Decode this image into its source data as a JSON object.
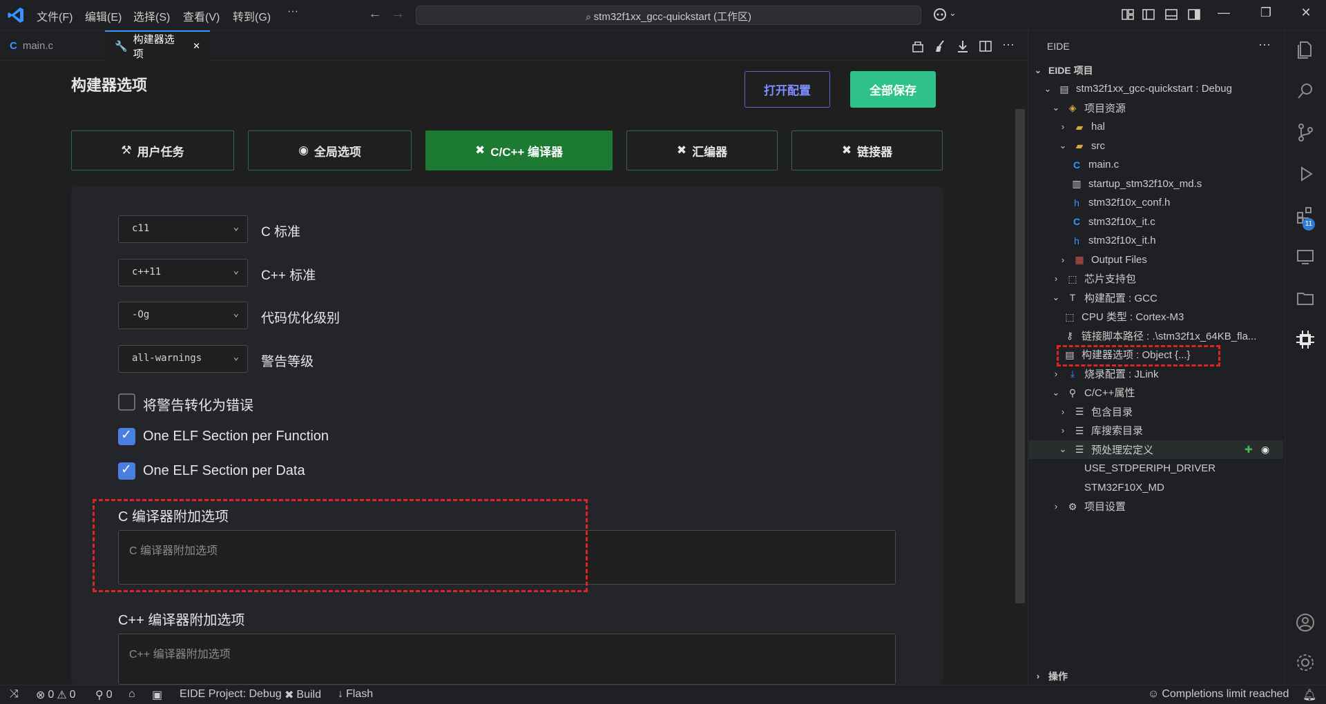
{
  "titlebar": {
    "menus": [
      "文件(F)",
      "编辑(E)",
      "选择(S)",
      "查看(V)",
      "转到(G)",
      "···"
    ],
    "search_text": "stm32f1xx_gcc-quickstart (工作区)"
  },
  "tabs": [
    {
      "label": "main.c",
      "icon": "c-file-icon"
    },
    {
      "label": "构建器选项",
      "icon": "wrench-icon",
      "close": "✕"
    }
  ],
  "editor": {
    "title": "构建器选项",
    "open_config": "打开配置",
    "save_all": "全部保存",
    "section_tabs": [
      "用户任务",
      "全局选项",
      "C/C++ 编译器",
      "汇编器",
      "链接器"
    ],
    "active_tab": "C/C++ 编译器",
    "selects": [
      {
        "value": "c11",
        "label": "C 标准"
      },
      {
        "value": "c++11",
        "label": "C++ 标准"
      },
      {
        "value": "-Og",
        "label": "代码优化级别"
      },
      {
        "value": "all-warnings",
        "label": "警告等级"
      }
    ],
    "checkboxes": [
      {
        "label": "将警告转化为错误",
        "checked": false
      },
      {
        "label": "One ELF Section per Function",
        "checked": true
      },
      {
        "label": "One ELF Section per Data",
        "checked": true
      }
    ],
    "c_extra": {
      "label": "C 编译器附加选项",
      "placeholder": "C 编译器附加选项"
    },
    "cpp_extra": {
      "label": "C++ 编译器附加选项",
      "placeholder": "C++ 编译器附加选项"
    }
  },
  "sidebar": {
    "title": "EIDE",
    "more": "···",
    "section": "EIDE 项目",
    "tree": [
      {
        "label": "stm32f1xx_gcc-quickstart : Debug",
        "chev": "⌄",
        "icon": "project-icon"
      },
      {
        "label": "项目资源",
        "chev": "⌄",
        "icon": "resources-icon"
      },
      {
        "label": "hal",
        "chev": "›",
        "icon": "folder-icon"
      },
      {
        "label": "src",
        "chev": "⌄",
        "icon": "folder-icon"
      },
      {
        "label": "main.c",
        "chev": "",
        "icon": "c-file-icon"
      },
      {
        "label": "startup_stm32f10x_md.s",
        "chev": "",
        "icon": "asm-file-icon"
      },
      {
        "label": "stm32f10x_conf.h",
        "chev": "",
        "icon": "h-file-icon"
      },
      {
        "label": "stm32f10x_it.c",
        "chev": "",
        "icon": "c-file-icon"
      },
      {
        "label": "stm32f10x_it.h",
        "chev": "",
        "icon": "h-file-icon"
      },
      {
        "label": "Output Files",
        "chev": "›",
        "icon": "output-icon"
      },
      {
        "label": "芯片支持包",
        "chev": "›",
        "icon": "chip-icon"
      },
      {
        "label": "构建配置 : GCC",
        "chev": "⌄",
        "icon": "hammer-icon"
      },
      {
        "label": "CPU 类型 : Cortex-M3",
        "chev": "",
        "icon": "cpu-icon"
      },
      {
        "label": "链接脚本路径 : .\\stm32f1x_64KB_fla...",
        "chev": "",
        "icon": "key-icon"
      },
      {
        "label": "构建器选项 : Object {...}",
        "chev": "",
        "icon": "options-icon"
      },
      {
        "label": "烧录配置 : JLink",
        "chev": "›",
        "icon": "download-icon"
      },
      {
        "label": "C/C++属性",
        "chev": "⌄",
        "icon": "wrench-icon"
      },
      {
        "label": "包含目录",
        "chev": "›",
        "icon": "list-icon"
      },
      {
        "label": "库搜索目录",
        "chev": "›",
        "icon": "list-icon"
      },
      {
        "label": "预处理宏定义",
        "chev": "⌄",
        "icon": "list-icon"
      },
      {
        "label": "USE_STDPERIPH_DRIVER",
        "chev": "",
        "icon": ""
      },
      {
        "label": "STM32F10X_MD",
        "chev": "",
        "icon": ""
      },
      {
        "label": "项目设置",
        "chev": "›",
        "icon": "gear-icon"
      }
    ],
    "bottom_section": "操作"
  },
  "activity_badge": "11",
  "statusbar": {
    "errors": "0",
    "warnings": "0",
    "ports": "0",
    "project": "EIDE Project: Debug",
    "build": "Build",
    "flash": "Flash",
    "completions": "Completions limit reached"
  },
  "colors": {
    "accent_green": "#1d7a33",
    "save_green": "#2ec28a",
    "open_blue": "#7f8eff",
    "highlight_red": "#e02424"
  }
}
